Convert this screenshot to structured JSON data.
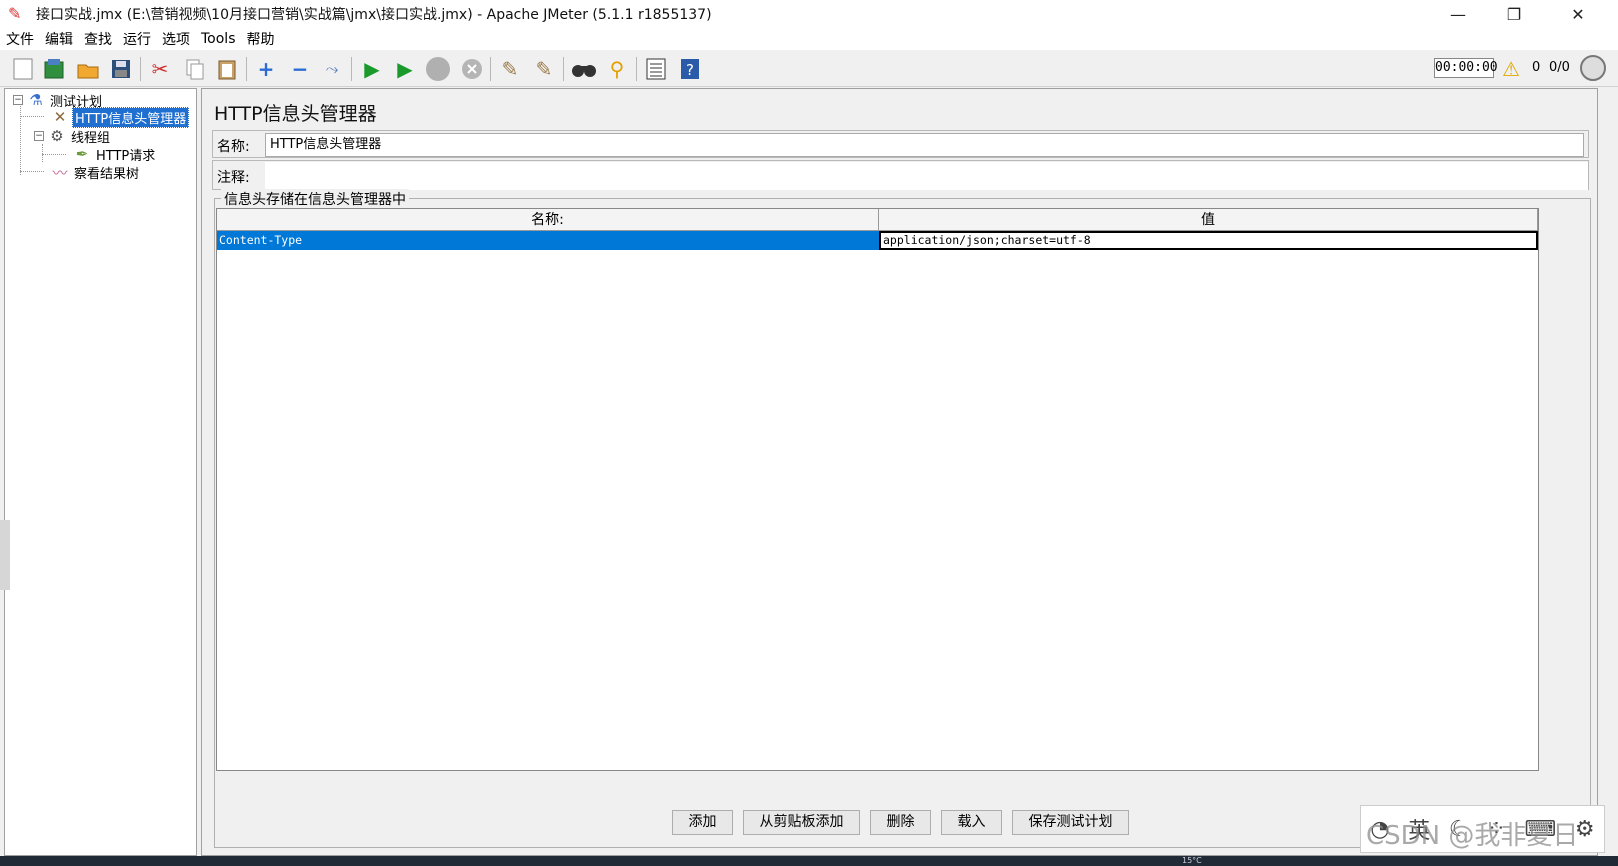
{
  "window": {
    "title": "接口实战.jmx (E:\\营销视频\\10月接口营销\\实战篇\\jmx\\接口实战.jmx) - Apache JMeter (5.1.1 r1855137)",
    "minimize": "—",
    "maximize": "❐",
    "close": "✕"
  },
  "menu": [
    "文件",
    "编辑",
    "查找",
    "运行",
    "选项",
    "Tools",
    "帮助"
  ],
  "toolbar": {
    "timer": "00:00:00",
    "warning_count": "0",
    "threads": "0/0",
    "icons": [
      "new-icon",
      "templates-icon",
      "open-icon",
      "save-icon",
      "cut-icon",
      "copy-icon",
      "paste-icon",
      "expand-icon",
      "collapse-icon",
      "toggle-icon",
      "start-icon",
      "start-no-pause-icon",
      "stop-icon",
      "shutdown-icon",
      "clear-icon",
      "clear-all-icon",
      "search-icon",
      "reset-search-icon",
      "function-helper-icon",
      "help-icon"
    ]
  },
  "tree": {
    "test_plan": "测试计划",
    "header_manager": "HTTP信息头管理器",
    "thread_group": "线程组",
    "http_request": "HTTP请求",
    "result_tree": "察看结果树"
  },
  "panel": {
    "title": "HTTP信息头管理器",
    "name_label": "名称:",
    "name_value": "HTTP信息头管理器",
    "comment_label": "注释:",
    "group_title": "信息头存储在信息头管理器中",
    "columns": [
      "名称:",
      "值"
    ],
    "rows": [
      {
        "name": "Content-Type",
        "value": "application/json;charset=utf-8"
      }
    ]
  },
  "buttons": {
    "add": "添加",
    "add_clipboard": "从剪贴板添加",
    "delete": "删除",
    "load": "载入",
    "save_plan": "保存测试计划"
  },
  "overlay": {
    "watermark": "CSDN @我非夏日",
    "ime": "英"
  },
  "taskbar": {
    "temperature": "15°C"
  }
}
